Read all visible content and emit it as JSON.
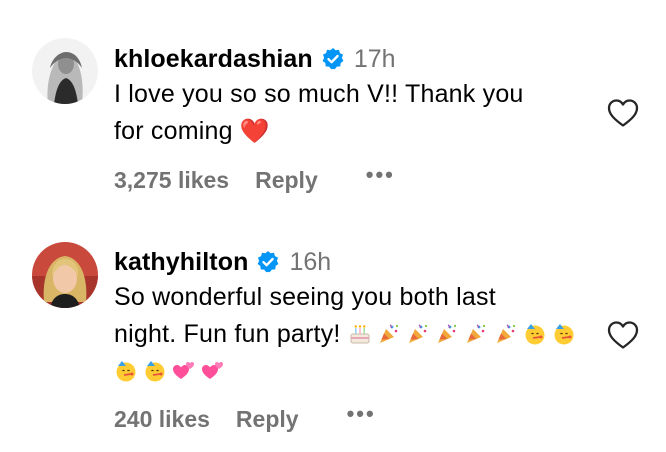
{
  "comments": [
    {
      "username": "khloekardashian",
      "time": "17h",
      "text_line1": "I love you so so much V!! Thank you",
      "text_line2": "for coming",
      "heart_emoji": "❤️",
      "likes": "3,275 likes",
      "reply": "Reply",
      "more": "•••"
    },
    {
      "username": "kathyhilton",
      "time": "16h",
      "text_line1": "So wonderful seeing you both last",
      "text_line2": "night. Fun fun party!",
      "likes": "240 likes",
      "reply": "Reply",
      "more": "•••"
    }
  ],
  "colors": {
    "verified_blue": "#0095f6",
    "muted_gray": "#737373",
    "heart_red": "#ed2a3a"
  }
}
